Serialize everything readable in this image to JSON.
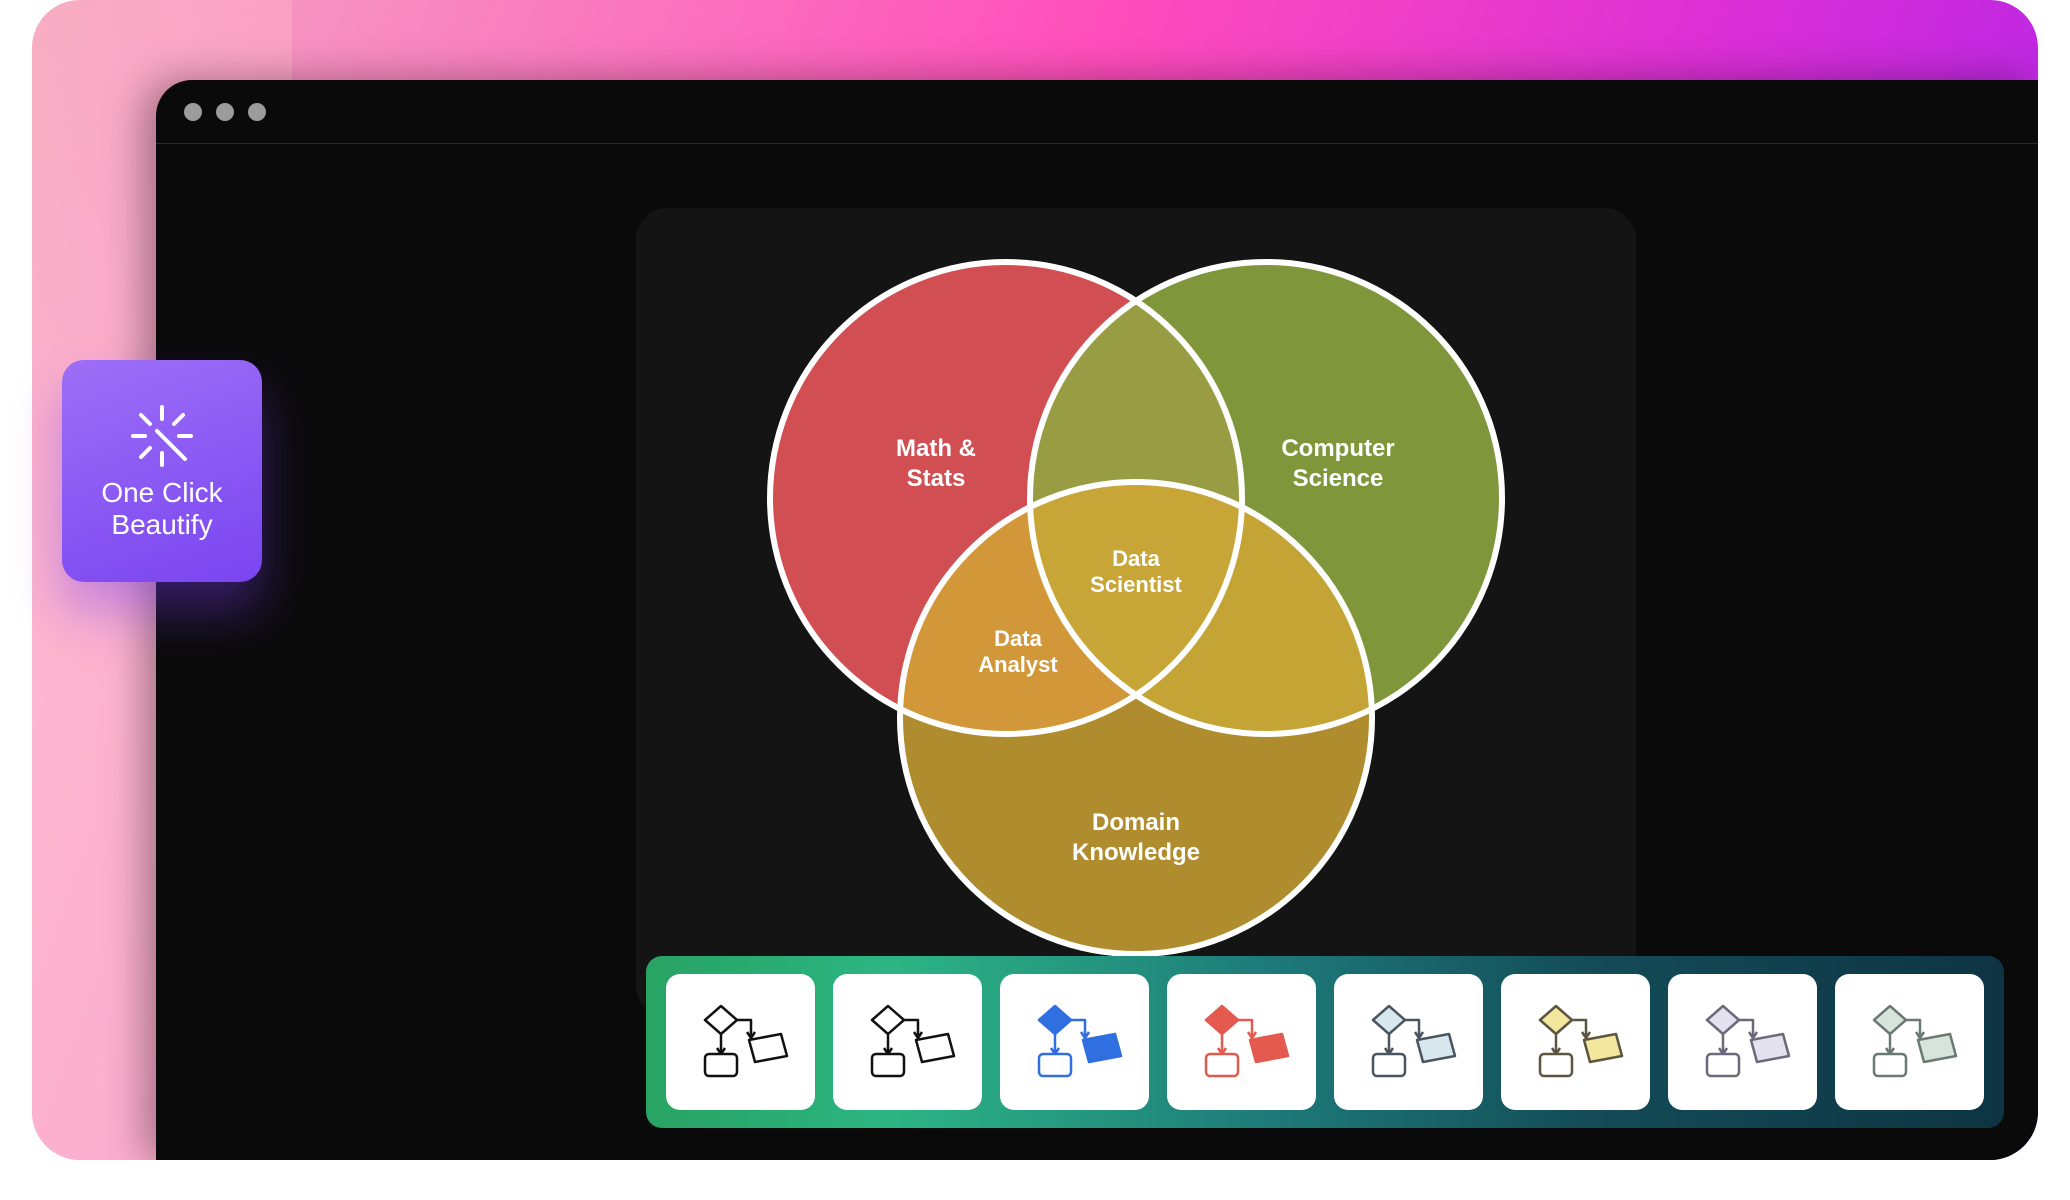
{
  "badge": {
    "line1": "One Click",
    "line2": "Beautify"
  },
  "venn": {
    "circle_a": {
      "line1": "Math &",
      "line2": "Stats",
      "color": "#d14f52"
    },
    "circle_b": {
      "line1": "Computer",
      "line2": "Science",
      "color": "#8fa941"
    },
    "circle_c": {
      "line1": "Domain",
      "line2": "Knowledge",
      "color": "#d2a733"
    },
    "overlap_ac": {
      "line1": "Data",
      "line2": "Analyst"
    },
    "overlap_center": {
      "line1": "Data",
      "line2": "Scientist"
    }
  },
  "themes": [
    {
      "name": "theme-dark-outline",
      "diamond": "#ffffff",
      "box": "#ffffff",
      "stroke": "#111"
    },
    {
      "name": "theme-black-outline",
      "diamond": "#ffffff",
      "box": "#ffffff",
      "stroke": "#111"
    },
    {
      "name": "theme-blue",
      "diamond": "#2f6fe0",
      "box": "#2f6fe0",
      "stroke": "#2f6fe0"
    },
    {
      "name": "theme-red",
      "diamond": "#e45a4f",
      "box": "#e45a4f",
      "stroke": "#e45a4f"
    },
    {
      "name": "theme-light-blue",
      "diamond": "#d8e8ef",
      "box": "#d8e8ef",
      "stroke": "#4a5560"
    },
    {
      "name": "theme-yellow",
      "diamond": "#f2e79c",
      "box": "#f2e79c",
      "stroke": "#5a5440"
    },
    {
      "name": "theme-lavender",
      "diamond": "#e5e2f0",
      "box": "#e5e2f0",
      "stroke": "#6a6a7a"
    },
    {
      "name": "theme-sage",
      "diamond": "#d6e4dc",
      "box": "#d6e4dc",
      "stroke": "#6a7a72"
    }
  ]
}
